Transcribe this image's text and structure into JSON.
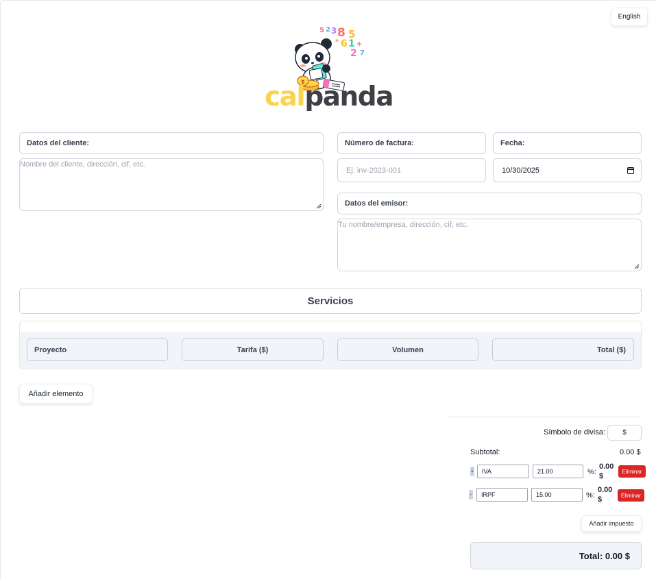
{
  "header": {
    "language_button": "English",
    "logo": {
      "word_part1": "cal",
      "word_part2": "panda",
      "numbers": "52385 *61+ 27"
    }
  },
  "client": {
    "label": "Datos del cliente:",
    "placeholder": "Nombre del cliente, dirección, cif, etc."
  },
  "invoice": {
    "number_label": "Número de factura:",
    "number_placeholder": "Ej: inv-2023-001",
    "date_label": "Fecha:",
    "date_value": "10/30/2025"
  },
  "issuer": {
    "label": "Datos del emisor:",
    "placeholder": "Tu nombre/empresa, dirección, cif, etc."
  },
  "services": {
    "title": "Servicios",
    "columns": [
      "Proyecto",
      "Tarifa ($)",
      "Volumen",
      "Total ($)"
    ],
    "add_item": "Añadir elemento"
  },
  "summary": {
    "currency_label": "Símbolo de divisa:",
    "currency_value": "$",
    "subtotal_label": "Subtotal:",
    "subtotal_value": "0.00 $",
    "taxes": [
      {
        "sign": "+",
        "name": "IVA",
        "rate": "21.00",
        "percent_label": "%:",
        "amount": "0.00",
        "currency": "$",
        "delete": "Eliminar"
      },
      {
        "sign": "-",
        "name": "IRPF",
        "rate": "15.00",
        "percent_label": "%:",
        "amount": "0.00",
        "currency": "$",
        "delete": "Eliminar"
      }
    ],
    "add_tax": "Añadir impuesto",
    "total": "Total: 0.00 $"
  },
  "colors": {
    "logo_yellow": "#fcd34d",
    "logo_dark": "#3f3f46",
    "delete_red": "#dc2626",
    "header_fill": "#f1f5f9"
  }
}
